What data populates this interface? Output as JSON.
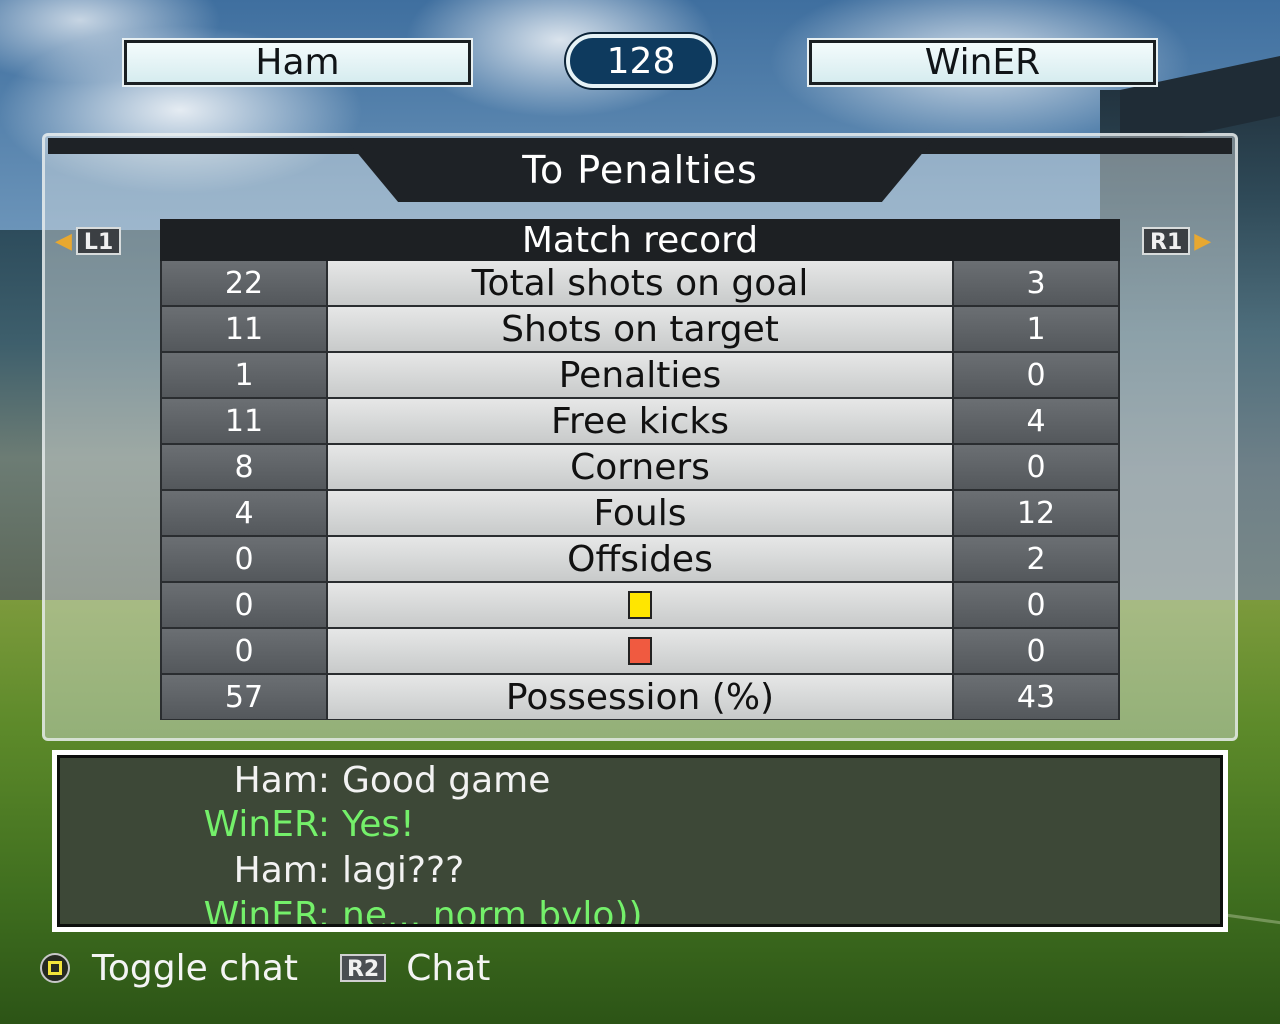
{
  "header": {
    "home_team": "Ham",
    "away_team": "WinER",
    "counter": "128"
  },
  "panel": {
    "title": "To Penalties",
    "left_button": "L1",
    "right_button": "R1",
    "table_title": "Match record",
    "rows": [
      {
        "home": "22",
        "label": "Total shots on goal",
        "away": "3"
      },
      {
        "home": "11",
        "label": "Shots on target",
        "away": "1"
      },
      {
        "home": "1",
        "label": "Penalties",
        "away": "0"
      },
      {
        "home": "11",
        "label": "Free kicks",
        "away": "4"
      },
      {
        "home": "8",
        "label": "Corners",
        "away": "0"
      },
      {
        "home": "4",
        "label": "Fouls",
        "away": "12"
      },
      {
        "home": "0",
        "label": "Offsides",
        "away": "2"
      },
      {
        "home": "0",
        "label": "",
        "icon": "yellow-card-icon",
        "away": "0"
      },
      {
        "home": "0",
        "label": "",
        "icon": "red-card-icon",
        "away": "0"
      },
      {
        "home": "57",
        "label": "Possession (%)",
        "away": "43"
      }
    ]
  },
  "chat": {
    "messages": [
      {
        "name": "Ham:",
        "text": "Good game",
        "color": "#f2f2f2"
      },
      {
        "name": "WinER:",
        "text": "Yes!",
        "color": "#74f06a"
      },
      {
        "name": "Ham:",
        "text": "lagi???",
        "color": "#f2f2f2"
      },
      {
        "name": "WinER:",
        "text": "ne... norm bylo))",
        "color": "#74f06a"
      }
    ]
  },
  "controls": {
    "toggle_chat_label": "Toggle chat",
    "chat_button": "R2",
    "chat_label": "Chat"
  },
  "colors": {
    "yellow_card": "#ffe600",
    "red_card": "#f05a40",
    "chat_green": "#74f06a",
    "score_pill": "#0e3a5e"
  }
}
